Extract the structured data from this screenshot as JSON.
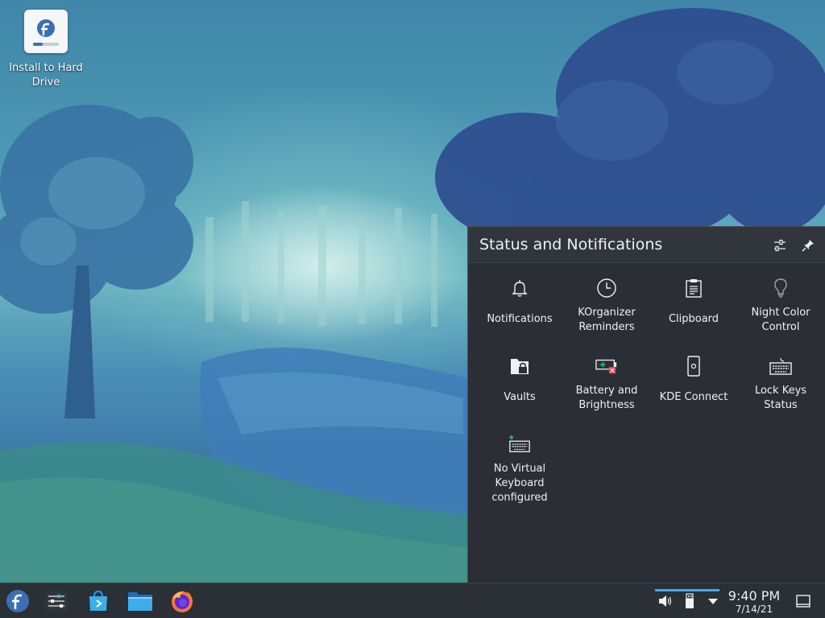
{
  "desktop": {
    "icons": [
      {
        "label": "Install to Hard Drive",
        "icon": "fedora-install-icon"
      }
    ]
  },
  "popup": {
    "title": "Status and Notifications",
    "header_buttons": [
      {
        "name": "configure-icon"
      },
      {
        "name": "pin-icon"
      }
    ],
    "items": [
      {
        "label": "Notifications",
        "icon": "bell-icon"
      },
      {
        "label": "KOrganizer Reminders",
        "icon": "clock-icon"
      },
      {
        "label": "Clipboard",
        "icon": "clipboard-icon"
      },
      {
        "label": "Night Color Control",
        "icon": "lightbulb-icon"
      },
      {
        "label": "Vaults",
        "icon": "folder-lock-icon"
      },
      {
        "label": "Battery and Brightness",
        "icon": "battery-icon"
      },
      {
        "label": "KDE Connect",
        "icon": "phone-icon"
      },
      {
        "label": "Lock Keys Status",
        "icon": "keyboard-icon"
      },
      {
        "label": "No Virtual Keyboard configured",
        "icon": "virtual-keyboard-icon"
      }
    ]
  },
  "taskbar": {
    "launchers": [
      {
        "name": "fedora-menu-icon"
      },
      {
        "name": "system-settings-icon"
      },
      {
        "name": "discover-icon"
      },
      {
        "name": "file-manager-icon"
      },
      {
        "name": "firefox-icon"
      }
    ],
    "tray": [
      {
        "name": "volume-icon"
      },
      {
        "name": "usb-device-icon"
      },
      {
        "name": "expand-tray-icon"
      }
    ],
    "clock": {
      "time": "9:40 PM",
      "date": "7/14/21"
    },
    "show_desktop": "show-desktop-icon"
  },
  "colors": {
    "accent": "#3daee9",
    "panel": "#2b2f36",
    "popup_bg": "#2b2f35"
  }
}
